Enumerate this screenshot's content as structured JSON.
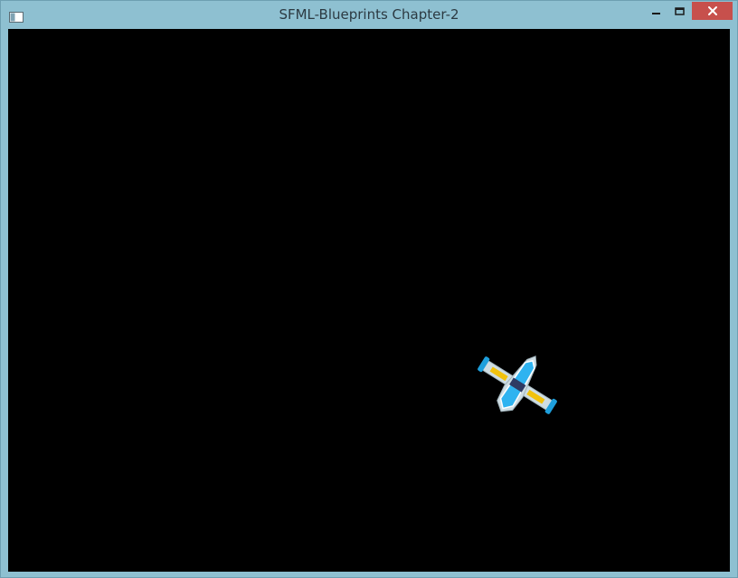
{
  "window": {
    "title": "SFML-Blueprints Chapter-2",
    "icons": {
      "app": "window-app-icon",
      "minimize": "minimize-icon",
      "maximize": "maximize-icon",
      "close": "close-icon"
    },
    "colors": {
      "frame": "#8ec0d1",
      "close_button": "#c7504c",
      "canvas": "#000000"
    }
  },
  "game": {
    "player_ship": {
      "icon": "spaceship-icon",
      "colors": {
        "hull": "#cfdde3",
        "wings": "#2fb3f0",
        "cockpit": "#2e3a63",
        "thrusters": "#f2c20d",
        "wing_tips": "#1e9fdc"
      }
    }
  }
}
